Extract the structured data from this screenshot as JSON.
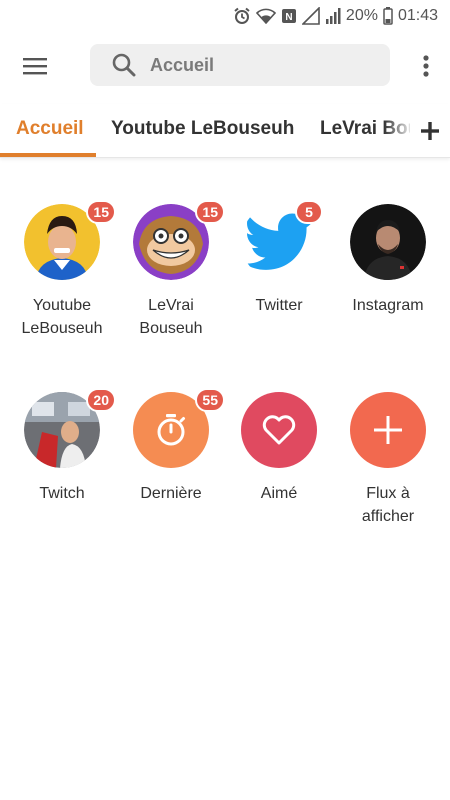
{
  "status_bar": {
    "battery_percent": "20%",
    "time": "01:43",
    "icons": [
      "alarm-icon",
      "wifi-icon",
      "nfc-icon",
      "signal-empty-icon",
      "signal-icon",
      "battery-icon"
    ]
  },
  "search": {
    "placeholder": "Accueil",
    "value": ""
  },
  "tabs": [
    {
      "label": "Accueil",
      "active": true
    },
    {
      "label": "Youtube LeBouseuh",
      "active": false
    },
    {
      "label": "LeVrai Bouseuh",
      "active": false
    }
  ],
  "colors": {
    "accent": "#e07f2c",
    "badge": "#e35a4b",
    "twitter": "#1da1f2",
    "derniere": "#f58c52",
    "aime": "#e04a60",
    "flux": "#f2694f"
  },
  "feeds": [
    {
      "label_line1": "Youtube",
      "label_line2": "LeBouseuh",
      "badge": "15",
      "icon": "youtube-lebouseuh-avatar"
    },
    {
      "label_line1": "LeVrai",
      "label_line2": "Bouseuh",
      "badge": "15",
      "icon": "levrai-bouseuh-avatar"
    },
    {
      "label_line1": "Twitter",
      "label_line2": "",
      "badge": "5",
      "icon": "twitter-icon"
    },
    {
      "label_line1": "Instagram",
      "label_line2": "",
      "badge": "",
      "icon": "instagram-avatar"
    },
    {
      "label_line1": "Twitch",
      "label_line2": "",
      "badge": "20",
      "icon": "twitch-avatar"
    },
    {
      "label_line1": "Dernière",
      "label_line2": "",
      "badge": "55",
      "icon": "timer-icon"
    },
    {
      "label_line1": "Aimé",
      "label_line2": "",
      "badge": "",
      "icon": "heart-icon"
    },
    {
      "label_line1": "Flux à",
      "label_line2": "afficher",
      "badge": "",
      "icon": "plus-icon"
    }
  ]
}
